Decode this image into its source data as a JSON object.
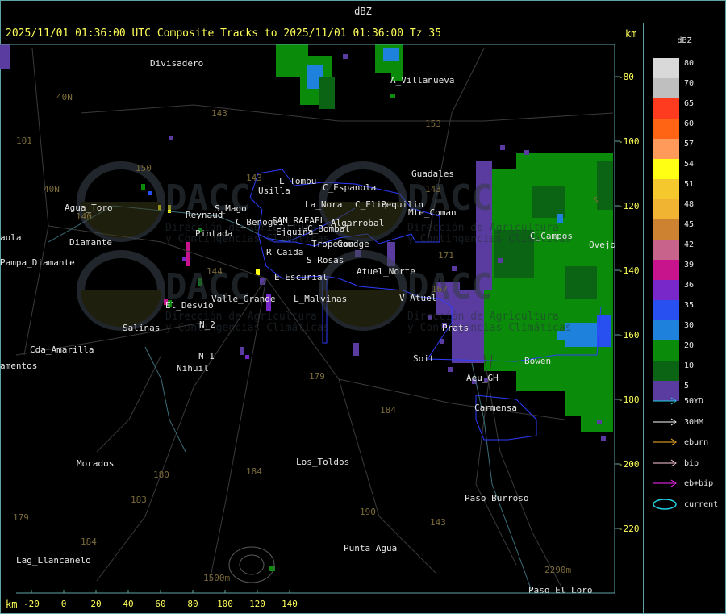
{
  "window_title": "dBZ",
  "map_title": "2025/11/01 01:36:00 UTC Composite Tracks to 2025/11/01 01:36:00 Tz 35",
  "unit_label": "km",
  "axis_x_ticks": [
    "-20",
    "0",
    "20",
    "40",
    "60",
    "80",
    "100",
    "120",
    "140"
  ],
  "axis_y_ticks": [
    "-80",
    "-100",
    "-120",
    "-140",
    "-160",
    "-180",
    "-200",
    "-220"
  ],
  "legend": {
    "title": "dBZ",
    "levels": [
      {
        "value": "80",
        "color": "#d9d9d9"
      },
      {
        "value": "70",
        "color": "#bfbfbf"
      },
      {
        "value": "65",
        "color": "#ff3b1f"
      },
      {
        "value": "60",
        "color": "#ff6414"
      },
      {
        "value": "57",
        "color": "#ff9a5a"
      },
      {
        "value": "54",
        "color": "#ffff14"
      },
      {
        "value": "51",
        "color": "#f5c82d"
      },
      {
        "value": "48",
        "color": "#f0b432"
      },
      {
        "value": "45",
        "color": "#cd8232"
      },
      {
        "value": "42",
        "color": "#c8648c"
      },
      {
        "value": "39",
        "color": "#c8148c"
      },
      {
        "value": "36",
        "color": "#7828c8"
      },
      {
        "value": "35",
        "color": "#2850f0"
      },
      {
        "value": "30",
        "color": "#1e82dc"
      },
      {
        "value": "20",
        "color": "#0a8c0a"
      },
      {
        "value": "10",
        "color": "#0a6414"
      },
      {
        "value": "5",
        "color": "#5a3ca0"
      }
    ],
    "tracks": [
      {
        "label": "50YD",
        "color": "#23d2e6"
      },
      {
        "label": "30HM",
        "color": "#ffffff"
      },
      {
        "label": "eburn",
        "color": "#ffb428"
      },
      {
        "label": "bip",
        "color": "#ffc8dc"
      },
      {
        "label": "eb+bip",
        "color": "#ff28ff"
      },
      {
        "label": "current",
        "color": "#23d2e6"
      }
    ]
  },
  "places": [
    "Divisadero",
    "A_Villanueva",
    "Guadales",
    "L_Tombu",
    "C_Espanola",
    "Usilla",
    "La_Nora",
    "C_Eliq",
    "Pequilin",
    "Mte_Coman",
    "Agua_Toro",
    "Reynaud",
    "S_Mago",
    "C_Benogui",
    "SAN_RAFAEL",
    "Algarrobal",
    "C_Bombal",
    "Tropezon",
    "Goudge",
    "Ejquiña",
    "R_Caida",
    "S_Rosas",
    "Atuel_Norte",
    "E_Escurial",
    "L_Malvinas",
    "V_Atuel",
    "El_Desvio",
    "Valle_Grande",
    "Salinas",
    "N_2",
    "N_1",
    "Nihuil",
    "Cda_Amarilla",
    "Prats",
    "Soit",
    "Aeu_GH",
    "Bowen",
    "C_Campos",
    "Ovejo",
    "Carmensa",
    "Morados",
    "Los_Toldos",
    "Paso_Burroso",
    "Punta_Agua",
    "Lag_Llancanelo",
    "Paso_El_Loro",
    "Pampa_Diamante",
    "aula",
    "amentos",
    "Pintada",
    "Diamante"
  ],
  "route_numbers": [
    "143",
    "153",
    "101",
    "150",
    "40N",
    "40N",
    "143",
    "143",
    "171",
    "167",
    "144",
    "179",
    "184",
    "180",
    "184",
    "183",
    "184",
    "179",
    "190",
    "143",
    "2290m",
    "1500m",
    "140",
    "S"
  ],
  "watermarks": [
    "DACC",
    "Dirección de Agricultura",
    "y Contingencias Climáticas"
  ]
}
